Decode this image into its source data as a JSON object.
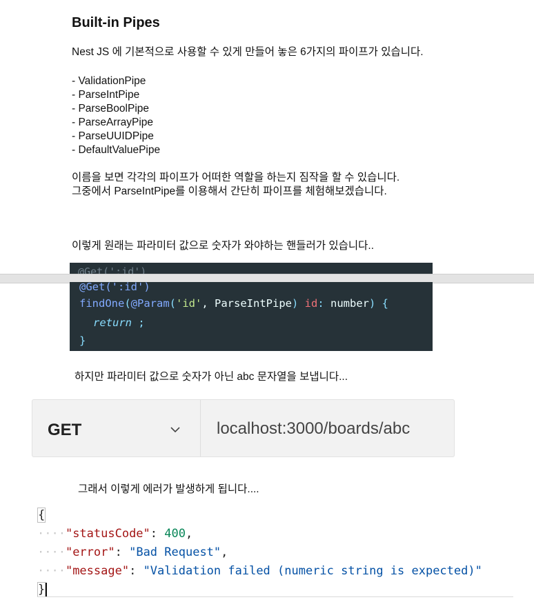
{
  "heading": "Built-in Pipes",
  "intro": "Nest JS 에 기본적으로 사용할 수 있게 만들어 놓은 6가지의 파이프가 있습니다.",
  "pipes": [
    "- ValidationPipe",
    "- ParseIntPipe",
    "- ParseBoolPipe",
    "- ParseArrayPipe",
    "- ParseUUIDPipe",
    "- DefaultValuePipe"
  ],
  "explain_line1": "이름을 보면 각각의 파이프가 어떠한 역할을 하는지 짐작을 할 수 있습니다.",
  "explain_line2": "그중에서 ParseIntPipe를 이용해서 간단히 파이프를 체험해보겠습니다.",
  "handler_note": "이렇게 원래는 파라미터 값으로 숫자가 와야하는 핸들러가 있습니다..",
  "code": {
    "ghost_line": "@Get(':id')",
    "decorator": "@Get(':id')",
    "fn_name": "findOne",
    "param_decorator": "@Param",
    "param_arg": "'id'",
    "pipe_name": "ParseIntPipe",
    "var_name": "id",
    "type_name": "number",
    "return_kw": "return",
    "return_tail": " ;",
    "close_brace": "}"
  },
  "abc_note": "하지만 파라미터 값으로 숫자가 아닌 abc 문자열을 보냅니다...",
  "request": {
    "method": "GET",
    "url": "localhost:3000/boards/abc",
    "chevron_icon": "chevron-down-icon"
  },
  "error_note": "그래서 이렇게 에러가 발생하게 됩니다....",
  "response": {
    "open_brace": "{",
    "close_brace": "}",
    "dots": "····",
    "status_key": "\"statusCode\"",
    "status_value": "400",
    "error_key": "\"error\"",
    "error_value": "\"Bad Request\"",
    "message_key": "\"message\"",
    "message_value": "\"Validation failed (numeric string is expected)\""
  }
}
